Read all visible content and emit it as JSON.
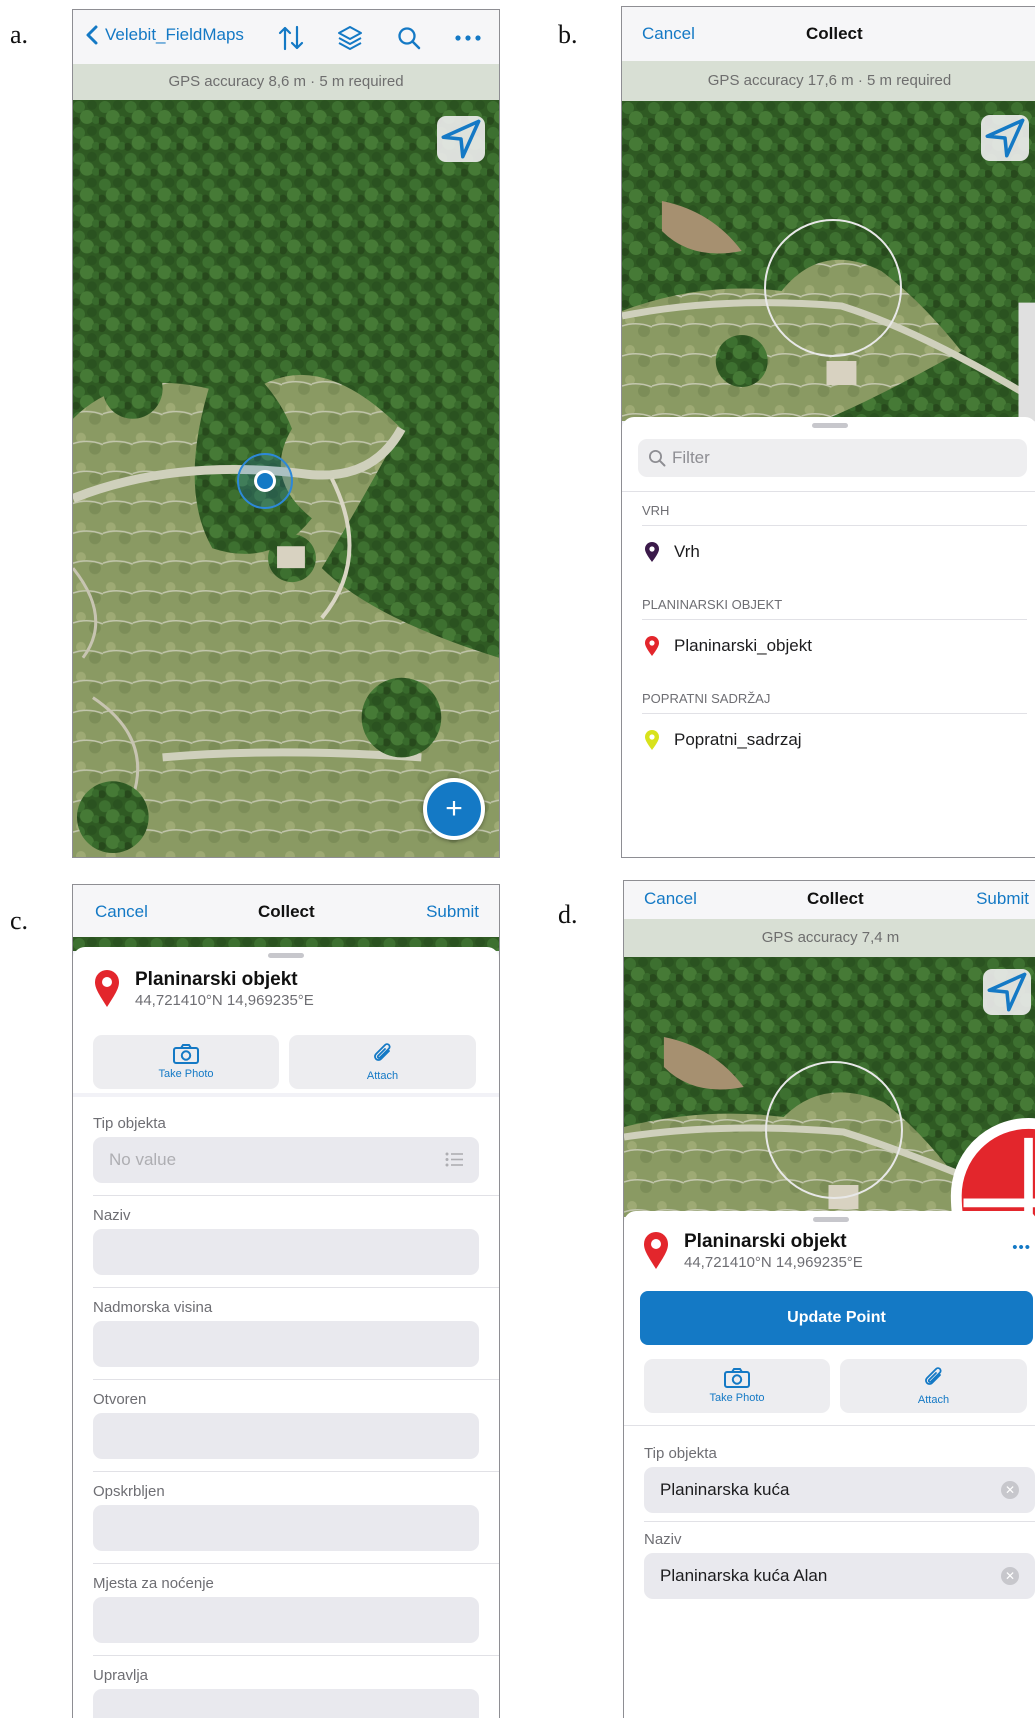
{
  "panel_letters": [
    "a.",
    "b.",
    "c.",
    "d."
  ],
  "panel_a": {
    "back_label": "Velebit_FieldMaps",
    "gps_accuracy": "GPS accuracy 8,6 m",
    "gps_separator": "·",
    "gps_required": "5 m required",
    "add_glyph": "+",
    "icons": [
      "chevron-left-icon",
      "sort-arrows-icon",
      "layers-icon",
      "search-icon",
      "more-icon",
      "locate-arrow-icon",
      "location-dot-icon",
      "add-icon"
    ]
  },
  "panel_b": {
    "cancel_label": "Cancel",
    "title": "Collect",
    "gps_accuracy": "GPS accuracy 17,6 m",
    "gps_separator": "·",
    "gps_required": "5 m required",
    "filter_placeholder": "Filter",
    "groups": [
      {
        "header": "VRH",
        "item": "Vrh",
        "pin_color": "#3b1a4a"
      },
      {
        "header": "PLANINARSKI OBJEKT",
        "item": "Planinarski_objekt",
        "pin_color": "#e3262c"
      },
      {
        "header": "POPRATNI SADRŽAJ",
        "item": "Popratni_sadrzaj",
        "pin_color": "#d8e21c"
      }
    ]
  },
  "panel_c": {
    "cancel_label": "Cancel",
    "title": "Collect",
    "submit_label": "Submit",
    "feature_title": "Planinarski objekt",
    "coords": "44,721410°N  14,969235°E",
    "take_photo": "Take Photo",
    "attach": "Attach",
    "fields": [
      {
        "label": "Tip objekta",
        "value": "No value"
      },
      {
        "label": "Naziv",
        "value": ""
      },
      {
        "label": "Nadmorska visina",
        "value": ""
      },
      {
        "label": "Otvoren",
        "value": ""
      },
      {
        "label": "Opskrbljen",
        "value": ""
      },
      {
        "label": "Mjesta za noćenje",
        "value": ""
      },
      {
        "label": "Upravlja",
        "value": ""
      }
    ]
  },
  "panel_d": {
    "cancel_label": "Cancel",
    "title": "Collect",
    "submit_label": "Submit",
    "gps_accuracy": "GPS accuracy 7,4 m",
    "feature_title": "Planinarski objekt",
    "coords": "44,721410°N  14,969235°E",
    "more_glyph": "•••",
    "update_label": "Update Point",
    "take_photo": "Take Photo",
    "attach": "Attach",
    "clear_glyph": "✕",
    "fields": [
      {
        "label": "Tip objekta",
        "value": "Planinarska kuća"
      },
      {
        "label": "Naziv",
        "value": "Planinarska kuća Alan"
      }
    ]
  },
  "colors": {
    "accent": "#1479c5",
    "pin_red": "#e3262c",
    "gps_bar": "#d8dfd4"
  }
}
